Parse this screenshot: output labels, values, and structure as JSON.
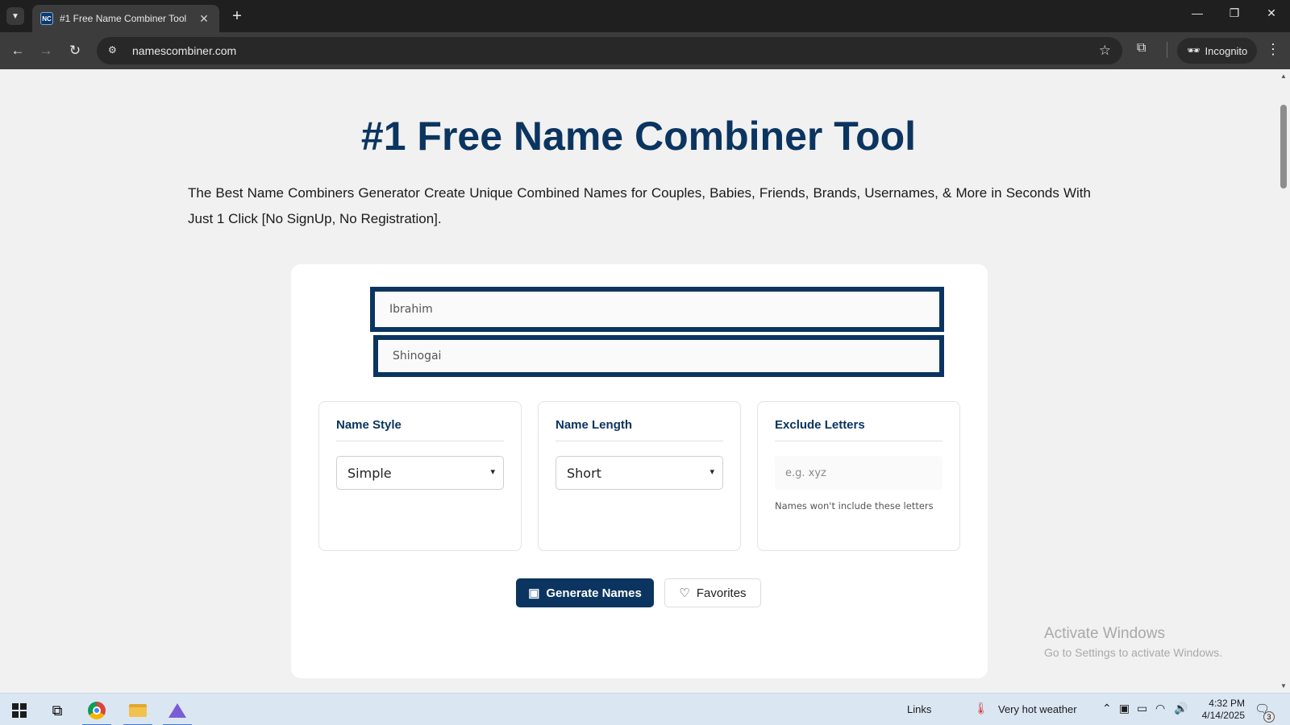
{
  "browser": {
    "tab_title": "#1 Free Name Combiner Tool",
    "favicon_text": "NC",
    "url": "namescombiner.com",
    "incognito_label": "Incognito"
  },
  "page": {
    "title": "#1 Free Name Combiner Tool",
    "intro": "The Best Name Combiners Generator Create Unique Combined Names for Couples, Babies, Friends, Brands, Usernames, & More in Seconds With Just 1 Click [No SignUp, No Registration]."
  },
  "form": {
    "name1_value": "Ibrahim",
    "name2_value": "Shinogai",
    "name_style": {
      "label": "Name Style",
      "selected": "Simple"
    },
    "name_length": {
      "label": "Name Length",
      "selected": "Short"
    },
    "exclude": {
      "label": "Exclude Letters",
      "placeholder": "e.g. xyz",
      "helper": "Names won't include these letters"
    },
    "generate_label": "Generate Names",
    "favorites_label": "Favorites"
  },
  "watermark": {
    "title": "Activate Windows",
    "subtitle": "Go to Settings to activate Windows."
  },
  "taskbar": {
    "links_label": "Links",
    "weather": "Very hot weather",
    "time": "4:32 PM",
    "date": "4/14/2025",
    "notification_count": "3"
  },
  "colors": {
    "brand": "#0b3560",
    "page_bg": "#f1f1f1",
    "chrome_dark": "#1f1f1f"
  }
}
